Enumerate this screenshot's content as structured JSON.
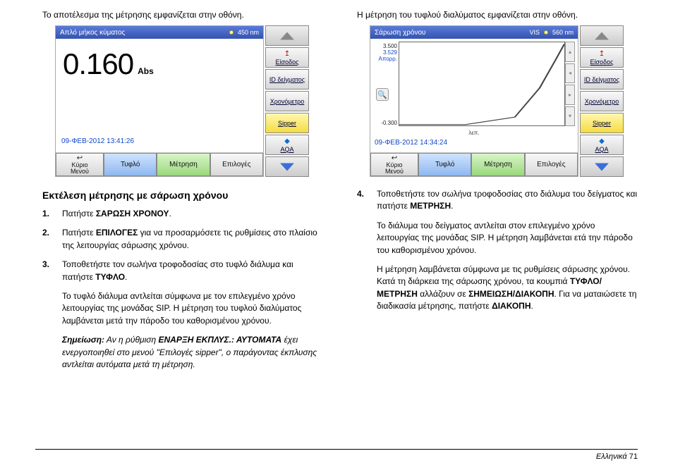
{
  "left": {
    "intro": "Το αποτέλεσμα της μέτρησης εμφανίζεται στην οθόνη.",
    "device": {
      "title": "Απλό μήκος κύματος",
      "wavelength": "450 nm",
      "reading": "0.160",
      "unit": "Abs",
      "timestamp": "09-ΦΕΒ-2012  13:41:26",
      "buttons": {
        "menu1": "Κύριο",
        "menu2": "Μενού",
        "blank": "Τυφλό",
        "measure": "Μέτρηση",
        "options": "Επιλογές"
      },
      "side": {
        "entry": "Είσοδος",
        "sampleid": "ID δείγματος",
        "timer": "Χρονόμετρο",
        "sipper": "Sipper",
        "aqa": "AQA"
      }
    },
    "heading": "Εκτέλεση μέτρησης με σάρωση χρόνου",
    "steps": {
      "s1a": "Πατήστε ",
      "s1b": "ΣΑΡΩΣΗ ΧΡΟΝΟΥ",
      "s1c": ".",
      "s2a": "Πατήστε ",
      "s2b": "ΕΠΙΛΟΓΕΣ",
      "s2c": " για να προσαρμόσετε τις ρυθμίσεις στο πλαίσιο της λειτουργίας σάρωσης χρόνου.",
      "s3a": "Τοποθετήστε τον σωλήνα τροφοδοσίας στο τυφλό διάλυμα και πατήστε ",
      "s3b": "ΤΥΦΛΟ",
      "s3c": ".",
      "s3p": "Το τυφλό διάλυμα αντλείται σύμφωνα με τον επιλεγμένο χρόνο λειτουργίας της μονάδας SIP. Η μέτρηση του τυφλού διαλύματος λαμβάνεται μετά την πάροδο του καθορισμένου χρόνου.",
      "noteLabel": "Σημείωση:",
      "noteA": " Αν η ρύθμιση ",
      "noteB": "ΕΝΑΡΞΗ ΕΚΠΛΥΣ.: ΑΥΤΟΜΑΤΑ",
      "noteC": "  έχει ενεργοποιηθεί στο μενού \"Επιλογές sipper\", ο παράγοντας έκπλυσης αντλείται αυτόματα μετά τη μέτρηση."
    }
  },
  "right": {
    "intro": "Η μέτρηση του τυφλού διαλύματος εμφανίζεται στην οθόνη.",
    "device": {
      "title": "Σάρωση χρόνου",
      "mode": "VIS",
      "wavelength": "560 nm",
      "ytop": "3.500",
      "ycur": "3.529",
      "ycurlbl": "Απορρ.",
      "ybot": "-0.300",
      "xlabel": "λεπ.",
      "timestamp": "09-ΦΕΒ-2012  14:34:24",
      "buttons": {
        "menu1": "Κύριο",
        "menu2": "Μενού",
        "blank": "Τυφλό",
        "measure": "Μέτρηση",
        "options": "Επιλογές"
      },
      "side": {
        "entry": "Είσοδος",
        "sampleid": "ID δείγματος",
        "timer": "Χρονόμετρο",
        "sipper": "Sipper",
        "aqa": "AQA"
      }
    },
    "steps": {
      "s4a": "Τοποθετήστε τον σωλήνα τροφοδοσίας στο διάλυμα του δείγματος και πατήστε ",
      "s4b": "ΜΕΤΡΗΣΗ",
      "s4c": ".",
      "p1": "Το διάλυμα του δείγματος αντλείται στον επιλεγμένο χρόνο λειτουργίας της μονάδας SIP. Η μέτρηση λαμβάνεται ετά την πάροδο του καθορισμένου χρόνου.",
      "p2a": "Η μέτρηση λαμβάνεται σύμφωνα με τις ρυθμίσεις σάρωσης χρόνου. Κατά τη διάρκεια της σάρωσης χρόνου, τα κουμπιά ",
      "p2b": "ΤΥΦΛΟ/ΜΕΤΡΗΣΗ",
      "p2c": " αλλάζουν σε ",
      "p2d": "ΣΗΜΕΙΩΣΗ/ΔΙΑΚΟΠΗ",
      "p2e": ". Για να ματαιώσετε τη διαδικασία μέτρησης, πατήστε ",
      "p2f": "ΔΙΑΚΟΠΗ",
      "p2g": "."
    }
  },
  "footer": {
    "lang": "Ελληνικά",
    "page": "71"
  },
  "chart_data": {
    "type": "line",
    "title": "Σάρωση χρόνου",
    "xlabel": "λεπ.",
    "ylabel": "Απορρ.",
    "ylim": [
      -0.3,
      3.5
    ],
    "current_value": 3.529,
    "wavelength_nm": 560,
    "series": [
      {
        "name": "Απορρ.",
        "x": [
          0,
          0.4,
          0.7,
          0.85,
          0.95,
          1.0
        ],
        "values": [
          -0.3,
          -0.3,
          0.2,
          1.4,
          2.6,
          3.5
        ]
      }
    ]
  }
}
